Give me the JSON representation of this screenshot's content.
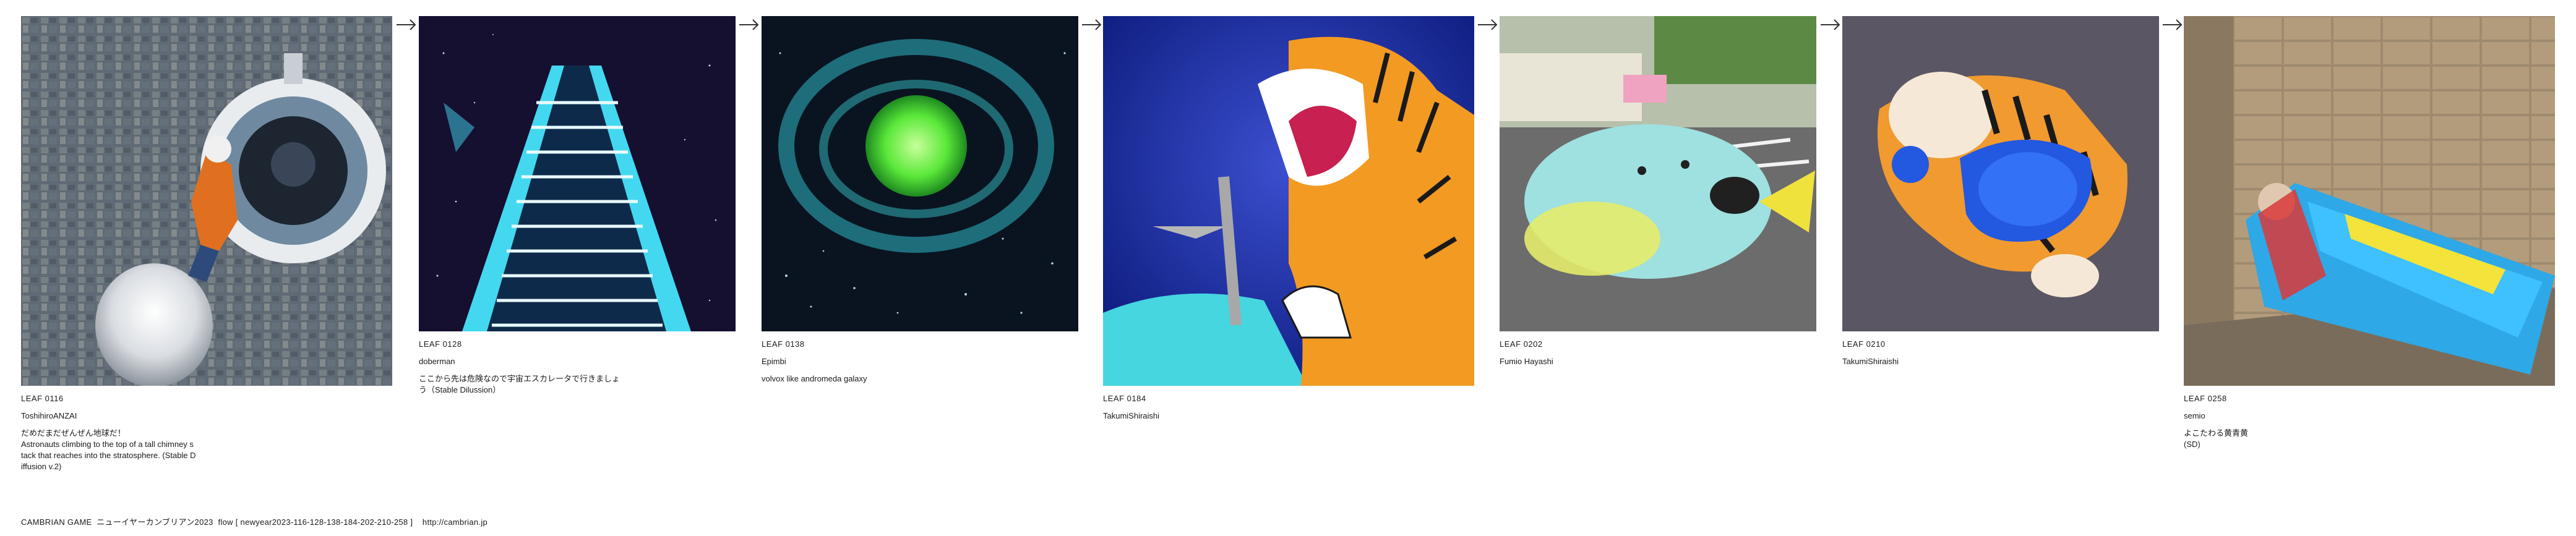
{
  "leaves": [
    {
      "id": "LEAF 0116",
      "author": "ToshihiroANZAI",
      "prompt": "だめだまだぜんぜん地球だ！\nAstronauts climbing to the top of a tall chimney s\ntack that reaches into the stratosphere. (Stable D\niffusion v.2)"
    },
    {
      "id": "LEAF 0128",
      "author": "doberman",
      "prompt": "ここから先は危険なので宇宙エスカレータで行きましょ\nう（Stable Dilussion）"
    },
    {
      "id": "LEAF 0138",
      "author": "Epimbi",
      "prompt": "volvox like andromeda galaxy"
    },
    {
      "id": "LEAF 0184",
      "author": "TakumiShiraishi",
      "prompt": ""
    },
    {
      "id": "LEAF 0202",
      "author": "Fumio Hayashi",
      "prompt": ""
    },
    {
      "id": "LEAF 0210",
      "author": "TakumiShiraishi",
      "prompt": ""
    },
    {
      "id": "LEAF 0258",
      "author": "semio",
      "prompt": "よこたわる黄青黄\n(SD)"
    }
  ],
  "footer": {
    "text": "CAMBRIAN GAME  ニューイヤーカンブリアン2023  flow [ newyear2023-116-128-138-184-202-210-258 ]    http://cambrian.jp"
  },
  "icons": {
    "arrow": "arrow-right-icon"
  }
}
